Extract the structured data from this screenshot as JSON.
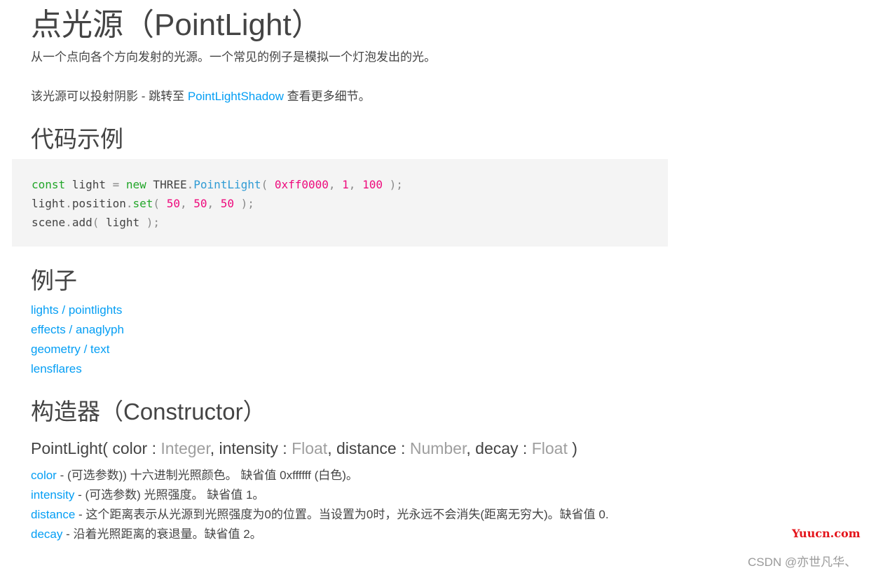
{
  "page": {
    "title": "点光源（PointLight）",
    "intro": "从一个点向各个方向发射的光源。一个常见的例子是模拟一个灯泡发出的光。",
    "shadow_note": {
      "prefix": "该光源可以投射阴影 - 跳转至 ",
      "link": "PointLightShadow",
      "suffix": " 查看更多细节。"
    }
  },
  "code_example": {
    "heading": "代码示例",
    "lines": [
      [
        {
          "t": "const",
          "c": "kw"
        },
        {
          "t": " light ",
          "c": ""
        },
        {
          "t": "=",
          "c": "punc"
        },
        {
          "t": " ",
          "c": ""
        },
        {
          "t": "new",
          "c": "kw"
        },
        {
          "t": " THREE",
          "c": ""
        },
        {
          "t": ".",
          "c": "punc"
        },
        {
          "t": "PointLight",
          "c": "fn"
        },
        {
          "t": "( ",
          "c": "punc"
        },
        {
          "t": "0xff0000",
          "c": "num"
        },
        {
          "t": ", ",
          "c": "punc"
        },
        {
          "t": "1",
          "c": "num"
        },
        {
          "t": ", ",
          "c": "punc"
        },
        {
          "t": "100",
          "c": "num"
        },
        {
          "t": " );",
          "c": "punc"
        }
      ],
      [
        {
          "t": "light",
          "c": ""
        },
        {
          "t": ".",
          "c": "punc"
        },
        {
          "t": "position",
          "c": ""
        },
        {
          "t": ".",
          "c": "punc"
        },
        {
          "t": "set",
          "c": "kw"
        },
        {
          "t": "( ",
          "c": "punc"
        },
        {
          "t": "50",
          "c": "num"
        },
        {
          "t": ", ",
          "c": "punc"
        },
        {
          "t": "50",
          "c": "num"
        },
        {
          "t": ", ",
          "c": "punc"
        },
        {
          "t": "50",
          "c": "num"
        },
        {
          "t": " );",
          "c": "punc"
        }
      ],
      [
        {
          "t": "scene",
          "c": ""
        },
        {
          "t": ".",
          "c": "punc"
        },
        {
          "t": "add",
          "c": ""
        },
        {
          "t": "( ",
          "c": "punc"
        },
        {
          "t": "light",
          "c": ""
        },
        {
          "t": " );",
          "c": "punc"
        }
      ]
    ]
  },
  "examples": {
    "heading": "例子",
    "links": [
      "lights / pointlights",
      "effects / anaglyph",
      "geometry / text",
      "lensflares"
    ]
  },
  "constructor": {
    "heading": "构造器（Constructor）",
    "signature": {
      "name": "PointLight( ",
      "params": [
        {
          "name": "color",
          "type": "Integer"
        },
        {
          "name": "intensity",
          "type": "Float"
        },
        {
          "name": "distance",
          "type": "Number"
        },
        {
          "name": "decay",
          "type": "Float"
        }
      ],
      "separator": " : ",
      "comma": ", ",
      "close": " )"
    },
    "params": [
      {
        "name": "color",
        "desc": " - (可选参数)) 十六进制光照颜色。 缺省值 0xffffff (白色)。"
      },
      {
        "name": "intensity",
        "desc": " - (可选参数) 光照强度。 缺省值 1。"
      },
      {
        "name": "distance",
        "desc": " - 这个距离表示从光源到光照强度为0的位置。当设置为0时，光永远不会消失(距离无穷大)。缺省值 0."
      },
      {
        "name": "decay",
        "desc": " - 沿着光照距离的衰退量。缺省值 2。"
      }
    ]
  },
  "watermarks": {
    "yuucn": "Yuucn.com",
    "csdn": "CSDN @亦世凡华、"
  },
  "colors": {
    "link": "#049ef4",
    "text": "#444444",
    "type": "#9e9e9e",
    "code_bg": "#f4f4f4",
    "code_keyword": "#22a629",
    "code_function": "#2f9bd4",
    "code_number": "#ee0a7c",
    "watermark_red": "#e4141b"
  }
}
